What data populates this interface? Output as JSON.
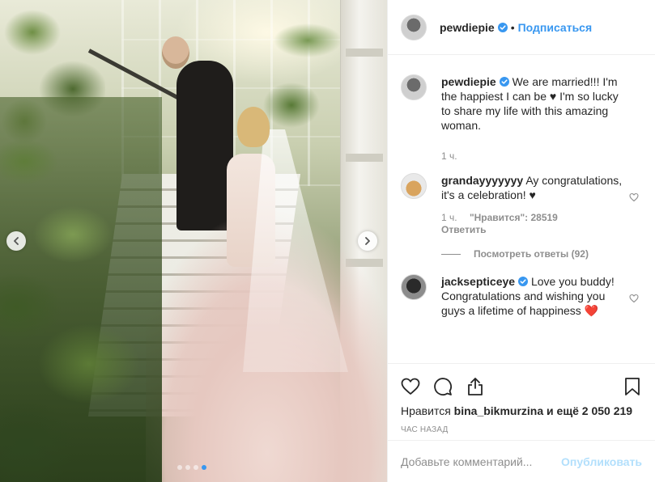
{
  "post": {
    "author": "pewdiepie",
    "separator": "•",
    "follow_label": "Подписаться"
  },
  "caption": {
    "username": "pewdiepie",
    "text": "We are married!!! I'm the happiest I can be ♥ I'm so lucky to share my life with this amazing woman.",
    "time": "1 ч."
  },
  "comments": [
    {
      "username": "grandayyyyyyy",
      "text": "Ay congratulations, it's a celebration! ♥",
      "time": "1 ч.",
      "likes": "\"Нравится\": 28519",
      "reply_label": "Ответить",
      "view_replies": "Посмотреть ответы (92)"
    },
    {
      "username": "jacksepticeye",
      "text": "Love you buddy! Congratulations and wishing you guys a lifetime of happiness ❤️"
    }
  ],
  "actions": {
    "icons": [
      "heart-icon",
      "comment-icon",
      "share-icon",
      "bookmark-icon"
    ],
    "likes_prefix": "Нравится",
    "likes_user": "bina_bikmurzina",
    "likes_suffix": "и ещё 2 050 219",
    "time_ago": "ЧАС НАЗАД"
  },
  "composer": {
    "placeholder": "Добавьте комментарий...",
    "publish_label": "Опубликовать"
  },
  "carousel": {
    "slide_count": 4,
    "active_index": 3
  },
  "colors": {
    "accent": "#3897f0",
    "publish_disabled": "#b2dffc",
    "secondary_text": "#8e8e8e",
    "heart_red": "#ed4956"
  }
}
